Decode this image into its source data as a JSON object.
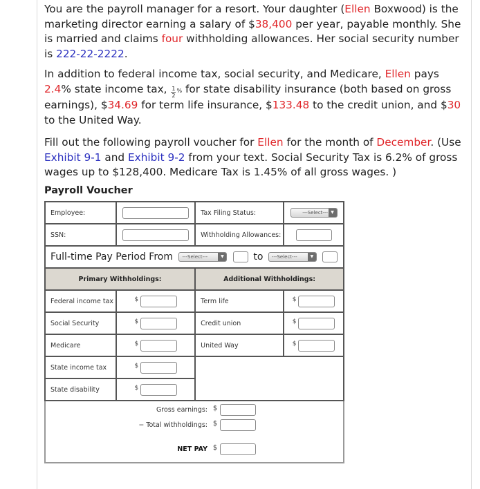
{
  "problem": {
    "p1": {
      "s1": "You are the payroll manager for a resort. Your daughter (",
      "name": "Ellen",
      "s2": " Boxwood) is the marketing director earning a salary of $",
      "salary": "38,400",
      "s3": " per year, payable monthly. She is married and claims ",
      "allowances": "four",
      "s4": " withholding allowances. Her social security number is ",
      "ssn": "222-22-2222",
      "s5": "."
    },
    "p2": {
      "s1": "In addition to federal income tax, social security, and Medicare, ",
      "name": "Ellen",
      "s2": " pays ",
      "state_rate": "2.4",
      "s3": "% state income tax, ",
      "frac_num": "1",
      "frac_den": "2",
      "frac_pct": "%",
      "s4": " for state disability insurance (both based on gross earnings), $",
      "term_life": "34.69",
      "s5": " for term life insurance, $",
      "credit_union": "133.48",
      "s6": " to the credit union, and $",
      "united_way": "30",
      "s7": " to the United Way."
    },
    "p3": {
      "s1": "Fill out the following payroll voucher for ",
      "name": "Ellen",
      "s2": " for the month of ",
      "month": "December",
      "s3": ". (Use ",
      "exhibit1": "Exhibit 9-1",
      "s4": " and ",
      "exhibit2": "Exhibit 9-2",
      "s5": " from your text. Social Security Tax is 6.2% of gross wages up to $128,400. Medicare Tax is 1.45% of all gross wages. )"
    }
  },
  "voucher": {
    "title": "Payroll Voucher",
    "employee_label": "Employee:",
    "employee_value": "",
    "tax_filing_label": "Tax Filing Status:",
    "tax_filing_select": "---Select---",
    "ssn_label": "SSN:",
    "ssn_value": "",
    "allowances_label": "Withholding Allowances:",
    "allowances_value": "",
    "pay_period_label": "Full-time Pay Period From",
    "from_select": "---Select---",
    "to_label": "to",
    "to_select": "---Select---",
    "primary_header": "Primary Withholdings:",
    "additional_header": "Additional Withholdings:",
    "currency": "$",
    "primary": [
      {
        "label": "Federal income tax",
        "value": ""
      },
      {
        "label": "Social Security",
        "value": ""
      },
      {
        "label": "Medicare",
        "value": ""
      },
      {
        "label": "State income tax",
        "value": ""
      },
      {
        "label": "State disability",
        "value": ""
      }
    ],
    "additional": [
      {
        "label": "Term life",
        "value": ""
      },
      {
        "label": "Credit union",
        "value": ""
      },
      {
        "label": "United Way",
        "value": ""
      }
    ],
    "gross_label": "Gross earnings:",
    "total_label": "− Total withholdings:",
    "net_label": "NET PAY"
  },
  "colors": {
    "highlight_red": "#e0262a",
    "highlight_blue": "#2a2fbf",
    "header_bg": "#dcd8d0"
  }
}
